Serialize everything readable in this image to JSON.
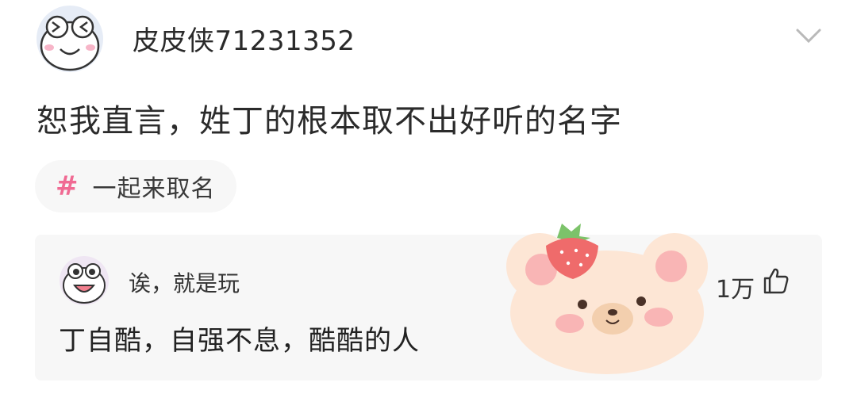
{
  "post": {
    "username": "皮皮侠71231352",
    "title": "恕我直言，姓丁的根本取不出好听的名字",
    "topic": "一起来取名",
    "topic_symbol": "#"
  },
  "comment": {
    "author": "诶，就是玩",
    "text": "丁自酷，自强不息，酷酷的人",
    "like_count": "1万"
  },
  "colors": {
    "accent_pink": "#f06a93",
    "card_bg": "#f7f7f7"
  },
  "icons": [
    "frog-avatar-icon",
    "chevron-down-icon",
    "hash-icon",
    "frog-face-avatar-icon",
    "thumbs-up-icon",
    "bear-strawberry-sticker"
  ]
}
